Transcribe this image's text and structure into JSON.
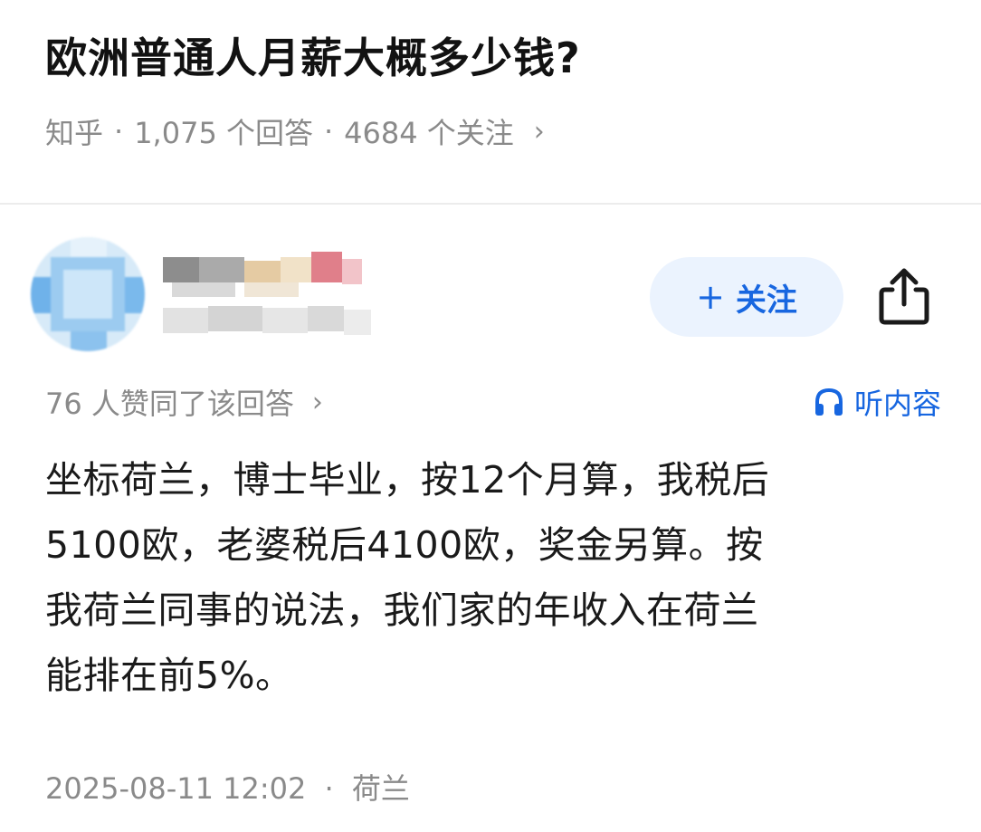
{
  "question": {
    "title": "欧洲普通人月薪大概多少钱?",
    "source": "知乎",
    "answers_count": "1,075 个回答",
    "followers_count": "4684 个关注",
    "separator": "·",
    "chevron": "›"
  },
  "author": {
    "avatar_icon": "avatar-blurred",
    "follow_label": "关注",
    "follow_plus": "+",
    "share_icon": "share-icon"
  },
  "answer": {
    "upvote_text": "76 人赞同了该回答",
    "upvote_chevron": "›",
    "listen_label": "听内容",
    "listen_icon": "headphones-icon",
    "body_lines": [
      "坐标荷兰，博士毕业，按12个月算，我税后",
      "5100欧，老婆税后4100欧，奖金另算。按",
      "我荷兰同事的说法，我们家的年收入在荷兰",
      "能排在前5%。"
    ],
    "timestamp": "2025-08-11 12:02",
    "separator": "·",
    "location": "荷兰"
  },
  "colors": {
    "accent": "#1766e0",
    "follow_bg": "#ebf3fe",
    "meta_gray": "#8a8a8a"
  }
}
